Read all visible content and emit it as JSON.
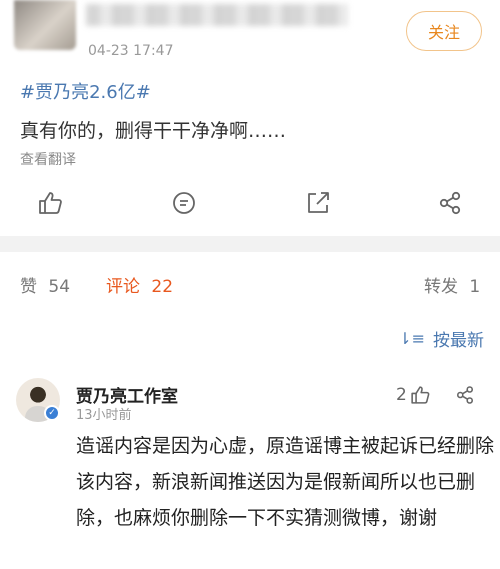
{
  "post": {
    "time": "04-23 17:47",
    "follow_label": "关注",
    "hashtag": "#贾乃亮2.6亿#",
    "body": "真有你的，删得干干净净啊……",
    "translate_label": "查看翻译"
  },
  "action_bar": {
    "icons": [
      "thumbs-up-icon",
      "comment-icon",
      "share-icon",
      "forward-icon"
    ]
  },
  "stats": {
    "likes_label": "赞",
    "likes_count": "54",
    "comments_label": "评论",
    "comments_count": "22",
    "reposts_label": "转发",
    "reposts_count": "1",
    "active_color": "#e8581f"
  },
  "sort": {
    "icon": "sort-icon",
    "label": "按最新"
  },
  "comment": {
    "author": "贾乃亮工作室",
    "time": "13小时前",
    "likes": "2",
    "verified_color": "#3a7fd5",
    "text": "造谣内容是因为心虚，原造谣博主被起诉已经删除该内容，新浪新闻推送因为是假新闻所以也已删除，也麻烦你删除一下不实猜测微博，谢谢"
  },
  "colors": {
    "link_blue": "#4a78b0",
    "follow_orange": "#e8871e"
  }
}
